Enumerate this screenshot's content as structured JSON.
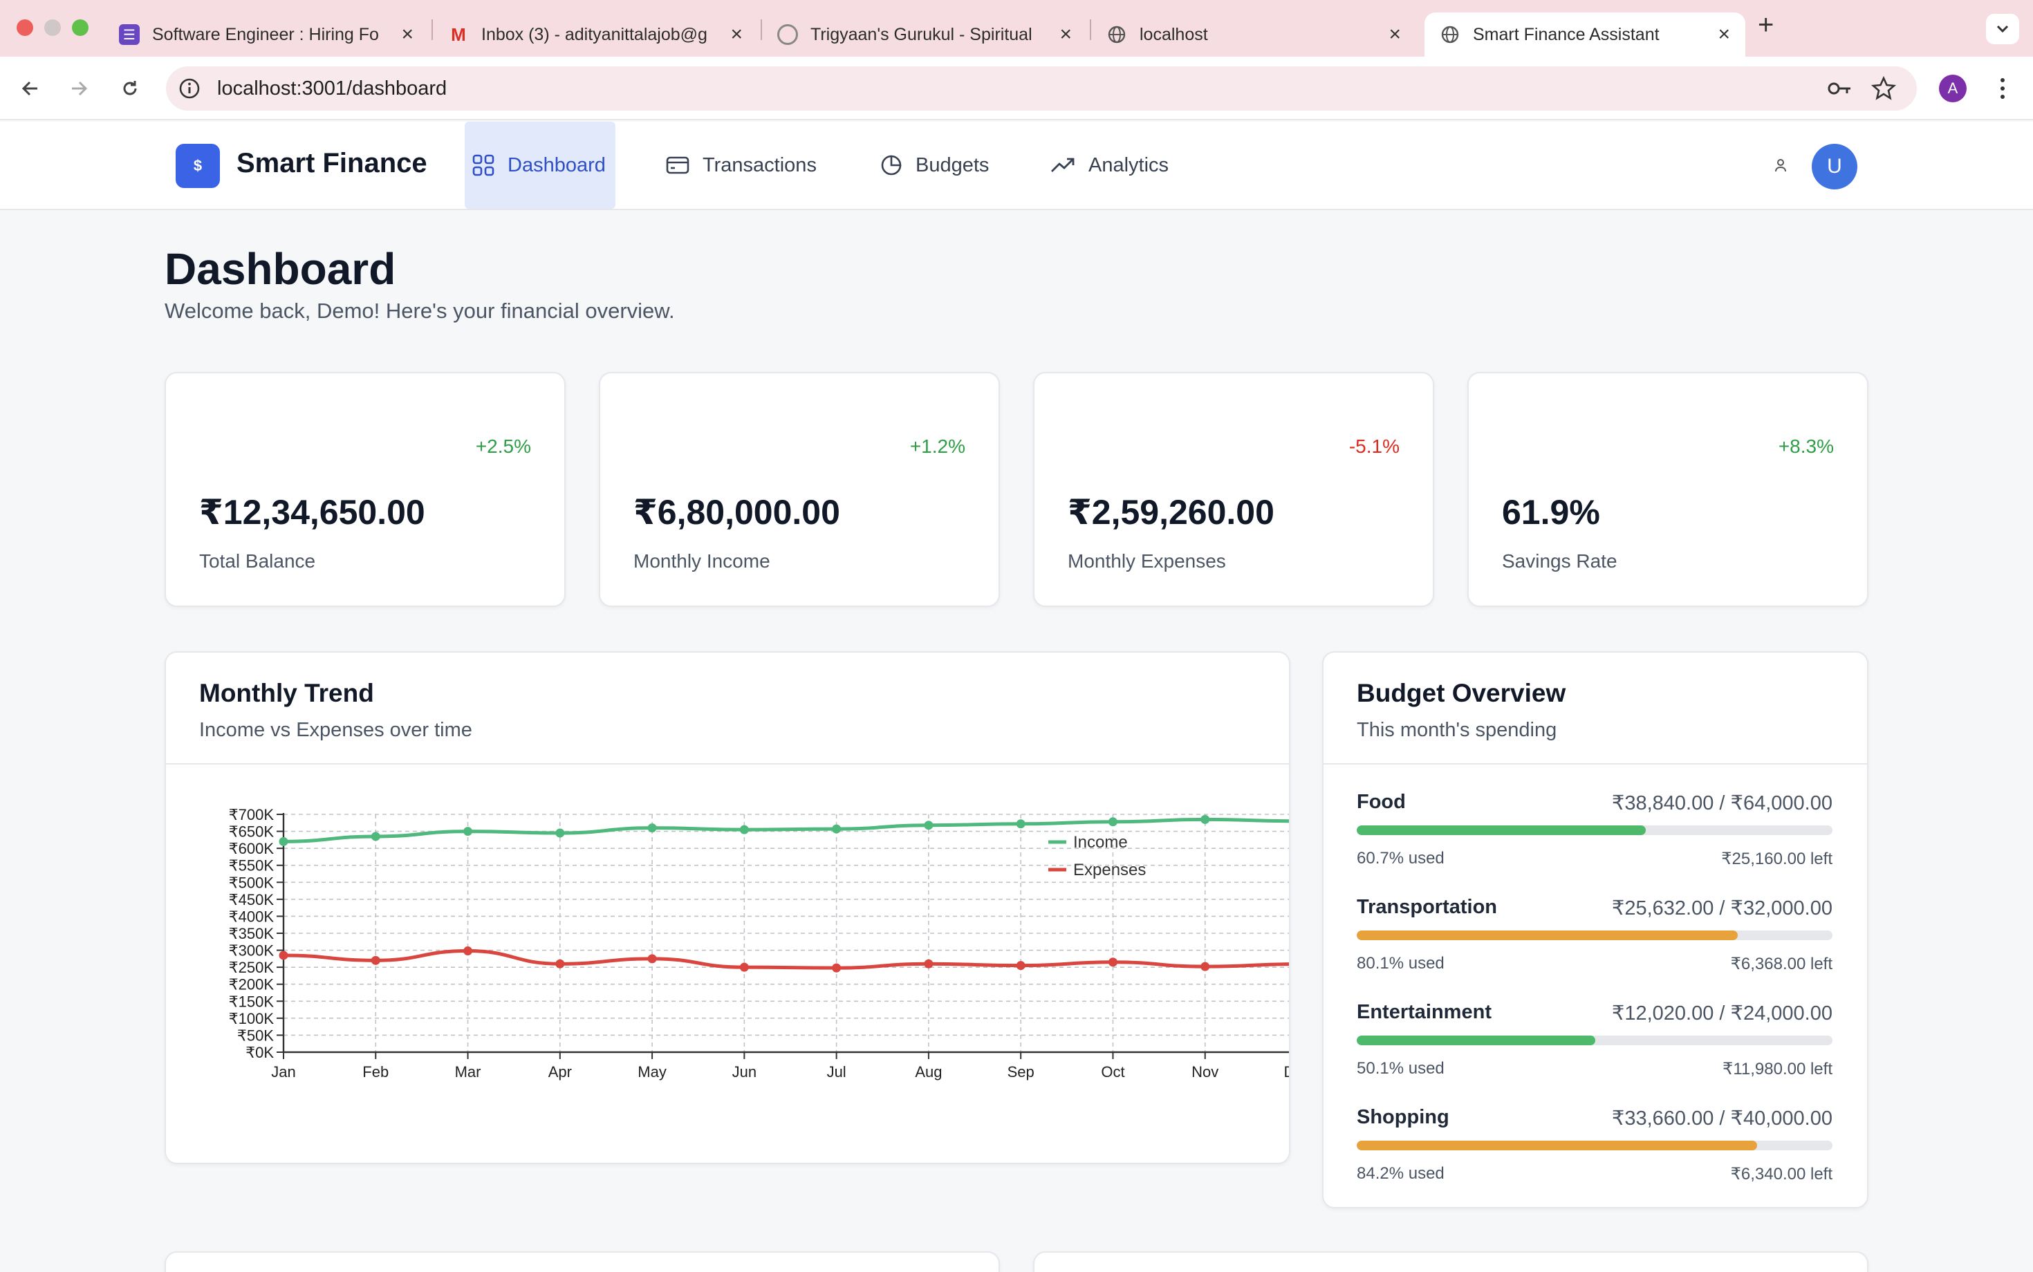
{
  "browser": {
    "tabs": [
      {
        "title": "Software Engineer : Hiring Fo",
        "icon": "forms-icon"
      },
      {
        "title": "Inbox (3) - adityanittalajob@g",
        "icon": "gmail-icon"
      },
      {
        "title": "Trigyaan's Gurukul - Spiritual",
        "icon": "spiral-icon"
      },
      {
        "title": "localhost",
        "icon": "globe-icon"
      },
      {
        "title": "Smart Finance Assistant",
        "icon": "globe-icon"
      }
    ],
    "url": "localhost:3001/dashboard",
    "profile_initial": "A"
  },
  "app": {
    "brand": "Smart Finance",
    "logo_symbol": "$",
    "nav": [
      {
        "label": "Dashboard",
        "icon": "grid-icon",
        "active": true
      },
      {
        "label": "Transactions",
        "icon": "card-icon",
        "active": false
      },
      {
        "label": "Budgets",
        "icon": "pie-icon",
        "active": false
      },
      {
        "label": "Analytics",
        "icon": "trending-up-icon",
        "active": false
      }
    ],
    "user_initial": "U"
  },
  "page": {
    "title": "Dashboard",
    "subtitle": "Welcome back, Demo! Here's your financial overview."
  },
  "stats": [
    {
      "value": "₹12,34,650.00",
      "label": "Total Balance",
      "change": "+2.5%",
      "trend": "up"
    },
    {
      "value": "₹6,80,000.00",
      "label": "Monthly Income",
      "change": "+1.2%",
      "trend": "up"
    },
    {
      "value": "₹2,59,260.00",
      "label": "Monthly Expenses",
      "change": "-5.1%",
      "trend": "down"
    },
    {
      "value": "61.9%",
      "label": "Savings Rate",
      "change": "+8.3%",
      "trend": "up"
    }
  ],
  "trend": {
    "title": "Monthly Trend",
    "subtitle": "Income vs Expenses over time"
  },
  "chart_data": {
    "type": "line",
    "title": "Monthly Trend",
    "subtitle": "Income vs Expenses over time",
    "x": [
      "Jan",
      "Feb",
      "Mar",
      "Apr",
      "May",
      "Jun",
      "Jul",
      "Aug",
      "Sep",
      "Oct",
      "Nov",
      "Dec"
    ],
    "series": [
      {
        "name": "Income",
        "color": "#4fb97d",
        "values": [
          620000,
          635000,
          650000,
          645000,
          660000,
          655000,
          657000,
          668000,
          672000,
          678000,
          685000,
          680000
        ]
      },
      {
        "name": "Expenses",
        "color": "#d9453f",
        "values": [
          285000,
          270000,
          298000,
          260000,
          275000,
          250000,
          248000,
          260000,
          255000,
          265000,
          252000,
          259260
        ]
      }
    ],
    "ylim": [
      0,
      700000
    ],
    "yticks": [
      "₹0K",
      "₹50K",
      "₹100K",
      "₹150K",
      "₹200K",
      "₹250K",
      "₹300K",
      "₹350K",
      "₹400K",
      "₹450K",
      "₹500K",
      "₹550K",
      "₹600K",
      "₹650K",
      "₹700K"
    ],
    "grid": true,
    "legend": "top-right"
  },
  "budget": {
    "title": "Budget Overview",
    "subtitle": "This month's spending",
    "items": [
      {
        "name": "Food",
        "amount": "₹38,840.00 / ₹64,000.00",
        "pct": 60.7,
        "used": "60.7% used",
        "left": "₹25,160.00 left",
        "color": "#4fb96b"
      },
      {
        "name": "Transportation",
        "amount": "₹25,632.00 / ₹32,000.00",
        "pct": 80.1,
        "used": "80.1% used",
        "left": "₹6,368.00 left",
        "color": "#e8a23c"
      },
      {
        "name": "Entertainment",
        "amount": "₹12,020.00 / ₹24,000.00",
        "pct": 50.1,
        "used": "50.1% used",
        "left": "₹11,980.00 left",
        "color": "#4fb96b"
      },
      {
        "name": "Shopping",
        "amount": "₹33,660.00 / ₹40,000.00",
        "pct": 84.2,
        "used": "84.2% used",
        "left": "₹6,340.00 left",
        "color": "#e8a23c"
      }
    ]
  }
}
